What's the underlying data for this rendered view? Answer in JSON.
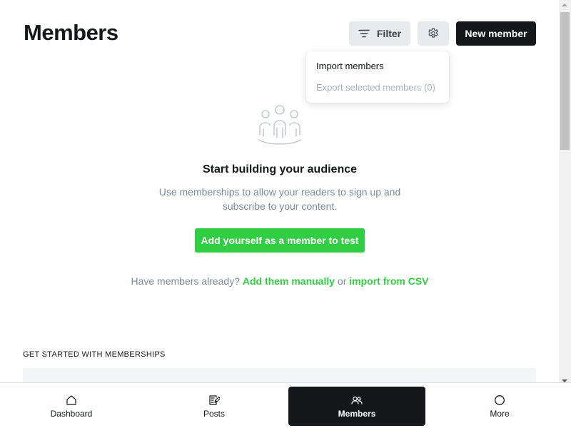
{
  "header": {
    "title": "Members",
    "filter_label": "Filter",
    "new_member_label": "New member"
  },
  "settings_menu": {
    "items": [
      {
        "label": "Import members",
        "disabled": false
      },
      {
        "label": "Export selected members (0)",
        "disabled": true
      }
    ]
  },
  "empty_state": {
    "icon": "members-group-icon",
    "title": "Start building your audience",
    "description": "Use memberships to allow your readers to sign up and subscribe to your content.",
    "add_self_label": "Add yourself as a member to test",
    "import_prefix": "Have members already?",
    "add_manually_label": "Add them manually",
    "or_text": "or",
    "import_csv_label": "import from CSV"
  },
  "get_started": {
    "heading": "GET STARTED WITH MEMBERSHIPS"
  },
  "bottom_nav": {
    "items": [
      {
        "label": "Dashboard",
        "icon": "home-icon",
        "active": false
      },
      {
        "label": "Posts",
        "icon": "posts-icon",
        "active": false
      },
      {
        "label": "Members",
        "icon": "members-icon",
        "active": true
      },
      {
        "label": "More",
        "icon": "more-icon",
        "active": false
      }
    ]
  },
  "colors": {
    "accent_green": "#30cf43",
    "dark": "#15171a",
    "muted_text": "#7c8b9a"
  }
}
